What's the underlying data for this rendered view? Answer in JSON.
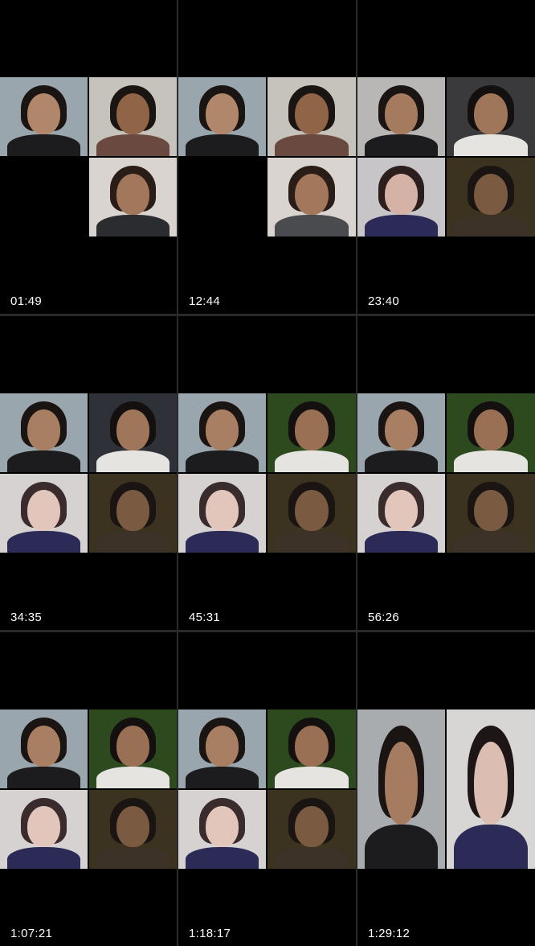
{
  "grid": {
    "columns": 3,
    "rows": 3,
    "cells": [
      {
        "timestamp": "01:49",
        "tiles": [
          {
            "wall": "#9aa6ad",
            "skin": "#b0876a",
            "hair": "#1a1412",
            "shirt": "#1c1c1e"
          },
          {
            "wall": "#c6c2bc",
            "skin": "#8f6447",
            "hair": "#1a1412",
            "shirt": "#6a4a40"
          },
          null,
          {
            "wall": "#d9d4cf",
            "skin": "#a3775c",
            "hair": "#2a1d17",
            "shirt": "#2a2c30"
          }
        ]
      },
      {
        "timestamp": "12:44",
        "tiles": [
          {
            "wall": "#9aa6ad",
            "skin": "#b0876a",
            "hair": "#1a1412",
            "shirt": "#1c1c1e"
          },
          {
            "wall": "#c6c2bc",
            "skin": "#8f6447",
            "hair": "#1a1412",
            "shirt": "#6a4a40"
          },
          null,
          {
            "wall": "#d9d4cf",
            "skin": "#a3775c",
            "hair": "#2a1d17",
            "shirt": "#4a4b4f"
          }
        ]
      },
      {
        "timestamp": "23:40",
        "tiles": [
          {
            "wall": "#b9b7b5",
            "skin": "#a57b5f",
            "hair": "#1a1412",
            "shirt": "#1c1c1e"
          },
          {
            "wall": "#3a3a3c",
            "skin": "#a0765a",
            "hair": "#141010",
            "shirt": "#e6e4e0"
          },
          {
            "wall": "#c7c5c8",
            "skin": "#d4b3a6",
            "hair": "#2b1e1c",
            "shirt": "#2c2a57"
          },
          {
            "wall": "#3b3320",
            "skin": "#7a5a40",
            "hair": "#1a1412",
            "shirt": "#3d3228"
          }
        ]
      },
      {
        "timestamp": "34:35",
        "tiles": [
          {
            "wall": "#9aa6ad",
            "skin": "#a97f63",
            "hair": "#1a1412",
            "shirt": "#1c1c1e"
          },
          {
            "wall": "#2e3138",
            "skin": "#a0765a",
            "hair": "#141010",
            "shirt": "#e6e4e0"
          },
          {
            "wall": "#d6d2d2",
            "skin": "#e3c6bb",
            "hair": "#3a2c2c",
            "shirt": "#2c2a57"
          },
          {
            "wall": "#3b3320",
            "skin": "#7a5a40",
            "hair": "#1a1412",
            "shirt": "#3d3228"
          }
        ]
      },
      {
        "timestamp": "45:31",
        "tiles": [
          {
            "wall": "#9aa6ad",
            "skin": "#a97f63",
            "hair": "#1a1412",
            "shirt": "#1c1c1e"
          },
          {
            "wall": "#2d4a1f",
            "skin": "#9a7055",
            "hair": "#141010",
            "shirt": "#e6e4e0"
          },
          {
            "wall": "#d6d2d2",
            "skin": "#e3c6bb",
            "hair": "#3a2c2c",
            "shirt": "#2c2a57"
          },
          {
            "wall": "#3b3320",
            "skin": "#7a5a40",
            "hair": "#1a1412",
            "shirt": "#3d3228"
          }
        ]
      },
      {
        "timestamp": "56:26",
        "tiles": [
          {
            "wall": "#9aa6ad",
            "skin": "#a97f63",
            "hair": "#1a1412",
            "shirt": "#1c1c1e"
          },
          {
            "wall": "#2d4a1f",
            "skin": "#9a7055",
            "hair": "#141010",
            "shirt": "#e6e4e0"
          },
          {
            "wall": "#d6d2d2",
            "skin": "#e3c6bb",
            "hair": "#3a2c2c",
            "shirt": "#2c2a57"
          },
          {
            "wall": "#3b3320",
            "skin": "#7a5a40",
            "hair": "#1a1412",
            "shirt": "#3d3228"
          }
        ]
      },
      {
        "timestamp": "1:07:21",
        "tiles": [
          {
            "wall": "#9aa6ad",
            "skin": "#a97f63",
            "hair": "#1a1412",
            "shirt": "#1c1c1e"
          },
          {
            "wall": "#2d4a1f",
            "skin": "#9a7055",
            "hair": "#141010",
            "shirt": "#e6e4e0"
          },
          {
            "wall": "#d6d2d2",
            "skin": "#e3c6bb",
            "hair": "#3a2c2c",
            "shirt": "#2c2a57"
          },
          {
            "wall": "#3b3320",
            "skin": "#7a5a40",
            "hair": "#1a1412",
            "shirt": "#3d3228"
          }
        ]
      },
      {
        "timestamp": "1:18:17",
        "tiles": [
          {
            "wall": "#9aa6ad",
            "skin": "#a97f63",
            "hair": "#1a1412",
            "shirt": "#1c1c1e"
          },
          {
            "wall": "#2d4a1f",
            "skin": "#9a7055",
            "hair": "#141010",
            "shirt": "#e6e4e0"
          },
          {
            "wall": "#d6d2d2",
            "skin": "#e3c6bb",
            "hair": "#3a2c2c",
            "shirt": "#2c2a57"
          },
          {
            "wall": "#3b3320",
            "skin": "#7a5a40",
            "hair": "#1a1412",
            "shirt": "#3d3228"
          }
        ]
      },
      {
        "timestamp": "1:29:12",
        "tiles": [
          {
            "wall": "#a9acaf",
            "skin": "#a67c60",
            "hair": "#1a1412",
            "shirt": "#1c1c1e"
          },
          {
            "wall": "#d8d6d4",
            "skin": "#dcbdb2",
            "hair": "#1e1616",
            "shirt": "#2c2a57"
          }
        ]
      }
    ]
  }
}
